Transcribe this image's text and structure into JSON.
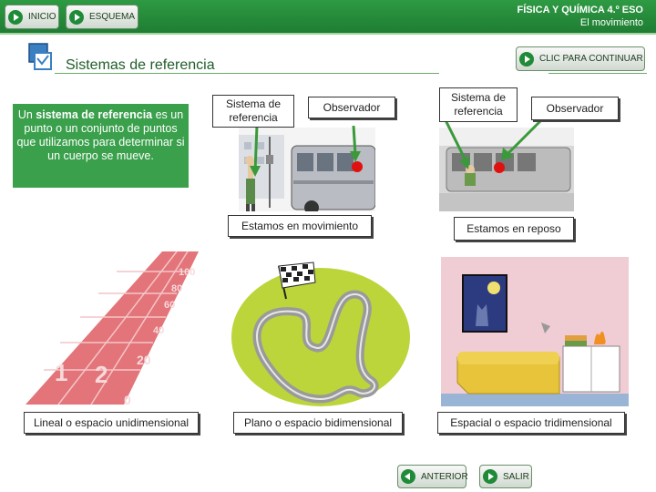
{
  "header": {
    "inicio_label": "INICIO",
    "esquema_label": "ESQUEMA",
    "subject": "FÍSICA Y QUÍMICA 4.º ESO",
    "unit": "El movimiento"
  },
  "page_title": "Sistemas de referencia",
  "continue_label": "CLIC PARA CONTINUAR",
  "definition": {
    "text_before": "Un ",
    "term": "sistema de referencia",
    "text_after": " es un punto o un conjunto de puntos que utilizamos para determinar si un cuerpo se mueve."
  },
  "scene_moving": {
    "reference_label": "Sistema de referencia",
    "observer_label": "Observador",
    "caption": "Estamos en movimiento"
  },
  "scene_rest": {
    "reference_label": "Sistema de referencia",
    "observer_label": "Observador",
    "caption": "Estamos en reposo"
  },
  "track_numbers": [
    "100",
    "80",
    "60",
    "40",
    "20",
    "0",
    "1",
    "2"
  ],
  "dimension_captions": {
    "one": "Lineal o espacio unidimensional",
    "two": "Plano o espacio bidimensional",
    "three": "Espacial o espacio tridimensional"
  },
  "footer": {
    "previous_label": "ANTERIOR",
    "exit_label": "SALIR"
  },
  "colors": {
    "header_green": "#1f7d33",
    "definition_green": "#3aa04c",
    "marker_red": "#e01010"
  }
}
